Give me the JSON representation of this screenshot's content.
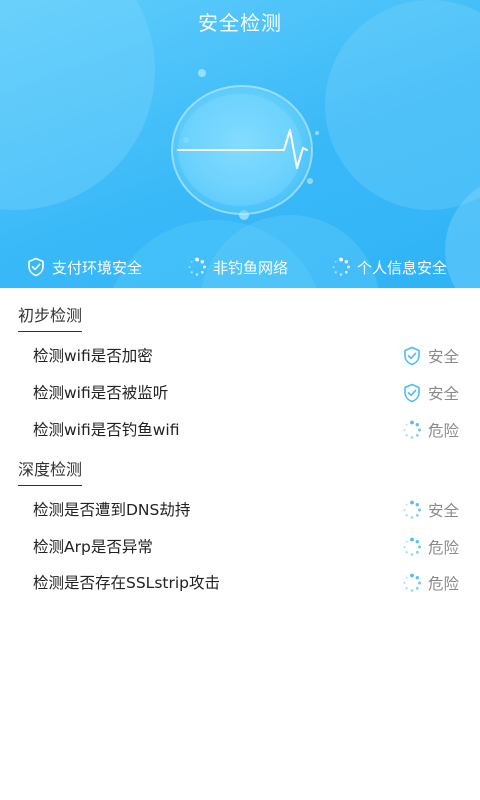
{
  "header": {
    "title": "安全检测"
  },
  "status_bar": {
    "items": [
      {
        "label": "支付环境安全",
        "icon": "shield-check-icon"
      },
      {
        "label": "非钓鱼网络",
        "icon": "loading-spinner-icon"
      },
      {
        "label": "个人信息安全",
        "icon": "loading-spinner-icon"
      }
    ]
  },
  "sections": [
    {
      "title": "初步检测",
      "checks": [
        {
          "label": "检测wifi是否加密",
          "status": "安全",
          "icon": "shield-check-icon"
        },
        {
          "label": "检测wifi是否被监听",
          "status": "安全",
          "icon": "shield-check-icon"
        },
        {
          "label": "检测wifi是否钓鱼wifi",
          "status": "危险",
          "icon": "loading-spinner-icon"
        }
      ]
    },
    {
      "title": "深度检测",
      "checks": [
        {
          "label": "检测是否遭到DNS劫持",
          "status": "安全",
          "icon": "loading-spinner-icon"
        },
        {
          "label": "检测Arp是否异常",
          "status": "危险",
          "icon": "loading-spinner-icon"
        },
        {
          "label": "检测是否存在SSLstrip攻击",
          "status": "危险",
          "icon": "loading-spinner-icon"
        }
      ]
    }
  ],
  "colors": {
    "hero_bg": "#3ab9f8",
    "accent": "#4bbcf4",
    "text_primary": "#222222",
    "text_secondary": "#8a8a8a"
  }
}
